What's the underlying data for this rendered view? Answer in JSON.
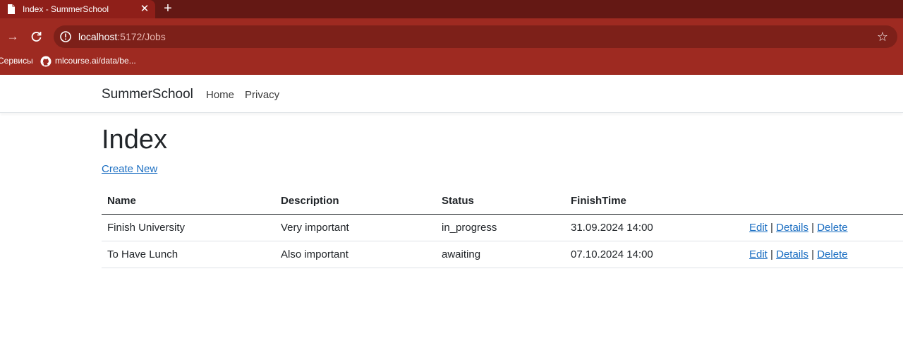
{
  "browser": {
    "tab_title": "Index - SummerSchool",
    "new_tab_icon": "plus-icon",
    "url_host": "localhost",
    "url_rest": ":5172/Jobs",
    "bookmarks": [
      {
        "label": "Сервисы"
      },
      {
        "label": "mlcourse.ai/data/be..."
      }
    ],
    "colors": {
      "tabbar": "#641814",
      "toolbar": "#9e2a21",
      "active_tab": "#8f1f19"
    }
  },
  "navbar": {
    "brand": "SummerSchool",
    "links": [
      "Home",
      "Privacy"
    ]
  },
  "main": {
    "title": "Index",
    "create_link": "Create New",
    "table": {
      "headers": [
        "Name",
        "Description",
        "Status",
        "FinishTime"
      ],
      "rows": [
        {
          "name": "Finish University",
          "description": "Very important",
          "status": "in_progress",
          "finish_time": "31.09.2024 14:00",
          "actions": [
            "Edit",
            "Details",
            "Delete"
          ]
        },
        {
          "name": "To Have Lunch",
          "description": "Also important",
          "status": "awaiting",
          "finish_time": "07.10.2024 14:00",
          "actions": [
            "Edit",
            "Details",
            "Delete"
          ]
        }
      ],
      "separator": "|"
    }
  },
  "colors": {
    "link": "#1b6ec2",
    "text": "#212529"
  }
}
